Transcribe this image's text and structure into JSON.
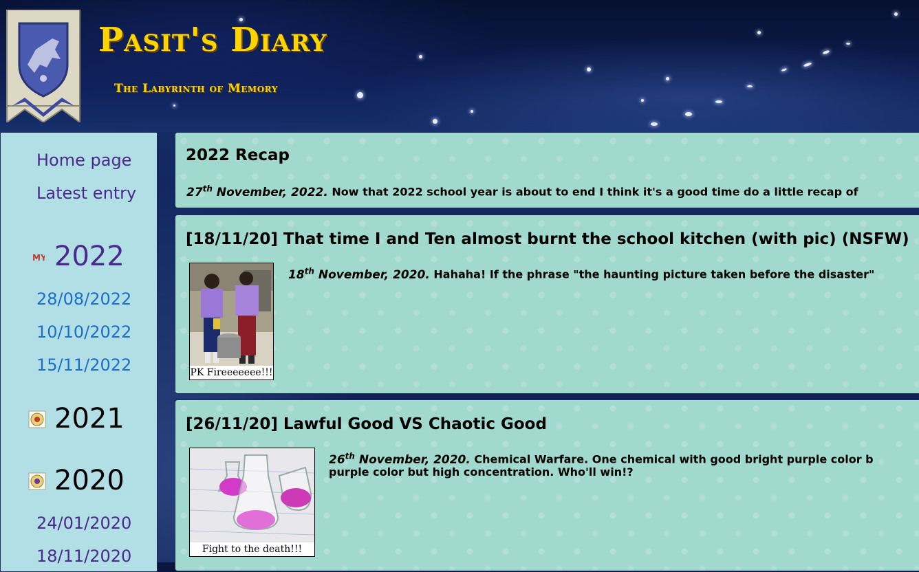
{
  "site": {
    "title": "Pasit's Diary",
    "subtitle": "The Labyrinth of Memory"
  },
  "sidebar": {
    "home_label": "Home page",
    "latest_label": "Latest entry",
    "years": [
      {
        "label": "2022",
        "dates": [
          "28/08/2022",
          "10/10/2022",
          "15/11/2022"
        ]
      },
      {
        "label": "2021",
        "dates": []
      },
      {
        "label": "2020",
        "dates": [
          "24/01/2020",
          "18/11/2020"
        ]
      }
    ]
  },
  "posts": [
    {
      "title": "2022 Recap",
      "day": "27",
      "suffix": "th",
      "rest_date": " November, 2022.",
      "body": " Now that 2022 school year is about to end I think it's a good time do a little recap of"
    },
    {
      "title": "[18/11/20] That time I and Ten almost burnt the school kitchen (with pic) (NSFW)",
      "day": "18",
      "suffix": "th",
      "rest_date": " November, 2020.",
      "body": " Hahaha! If the phrase \"the haunting picture taken before the disaster\"",
      "caption": "PK Fireeeeeee!!!"
    },
    {
      "title": "[26/11/20] Lawful Good VS Chaotic Good",
      "day": "26",
      "suffix": "th",
      "rest_date": " November, 2020.",
      "body": " Chemical Warfare. One chemical with good bright purple color b",
      "body2": "purple color but high concentration. Who'll win!?",
      "caption": "Fight to the death!!!"
    }
  ],
  "colors": {
    "title_gold": "#ffd400",
    "sidebar_bg": "#b2dfe5",
    "post_bg": "#a1d9cf",
    "link_purple": "#4a2a8c",
    "link_blue": "#1a6fc8"
  }
}
